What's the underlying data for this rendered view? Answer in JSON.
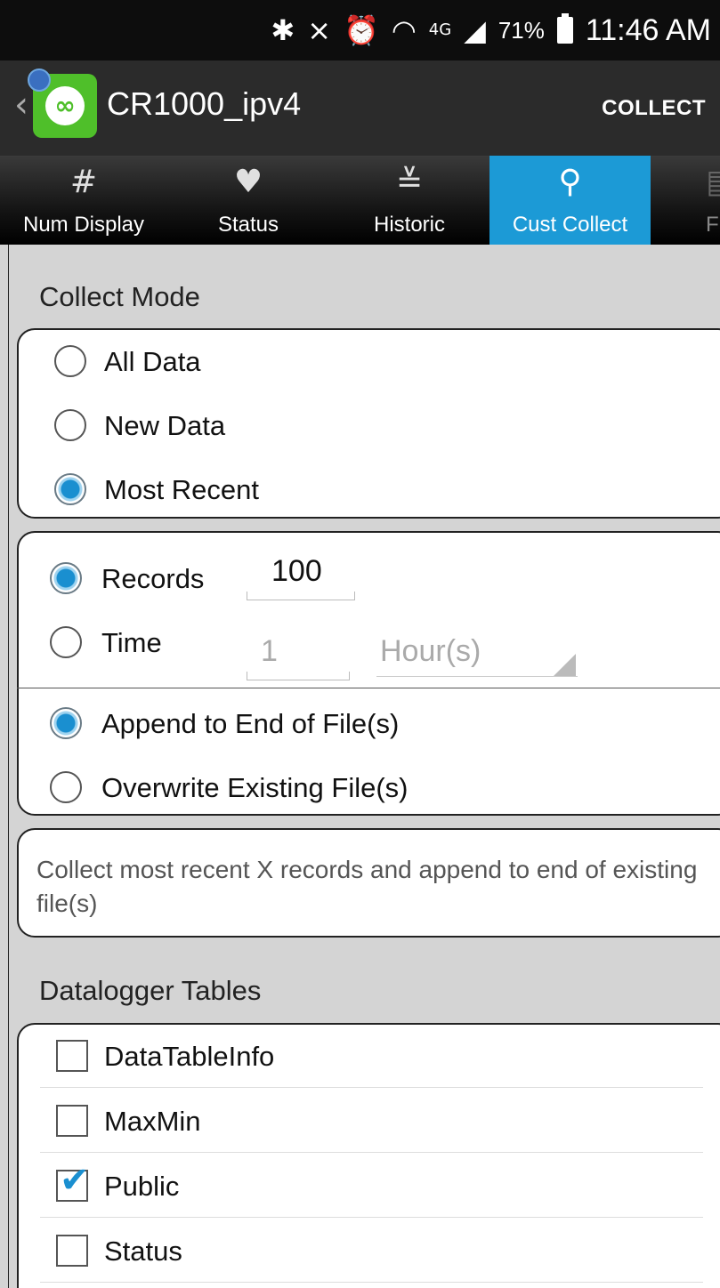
{
  "status_bar": {
    "icons": [
      "bluetooth-icon",
      "mute-icon",
      "alarm-icon",
      "wifi-icon",
      "network-4g-icon",
      "signal-icon"
    ],
    "network": "4G",
    "battery_percent": "71%",
    "time": "11:46 AM"
  },
  "action_bar": {
    "title": "CR1000_ipv4",
    "action": "COLLECT"
  },
  "tabs": [
    {
      "label": "Num Display",
      "icon": "hash-icon",
      "glyph": "#"
    },
    {
      "label": "Status",
      "icon": "heart-icon",
      "glyph": "♥"
    },
    {
      "label": "Historic",
      "icon": "historic-icon",
      "glyph": "≚"
    },
    {
      "label": "Cust Collect",
      "icon": "butterfly-net-icon",
      "glyph": "⚲",
      "active": true
    },
    {
      "label": "F",
      "icon": "table-icon",
      "glyph": "▤"
    }
  ],
  "collect_mode": {
    "title": "Collect Mode",
    "options": [
      {
        "label": "All Data",
        "selected": false
      },
      {
        "label": "New Data",
        "selected": false
      },
      {
        "label": "Most Recent",
        "selected": true
      }
    ]
  },
  "amount": {
    "records_label": "Records",
    "records_value": "100",
    "records_selected": true,
    "time_label": "Time",
    "time_value": "1",
    "time_unit": "Hour(s)",
    "time_selected": false
  },
  "file_mode": {
    "append_label": "Append to End of File(s)",
    "append_selected": true,
    "overwrite_label": "Overwrite Existing File(s)",
    "overwrite_selected": false
  },
  "description": "Collect most recent X records and append to end of existing file(s)",
  "tables": {
    "title": "Datalogger Tables",
    "items": [
      {
        "label": "DataTableInfo",
        "checked": false
      },
      {
        "label": "MaxMin",
        "checked": false
      },
      {
        "label": "Public",
        "checked": true
      },
      {
        "label": "Status",
        "checked": false
      }
    ]
  },
  "colors": {
    "accent": "#1c9ad6",
    "action_bar": "#2b2b2b",
    "app_icon": "#4fbf2a"
  }
}
